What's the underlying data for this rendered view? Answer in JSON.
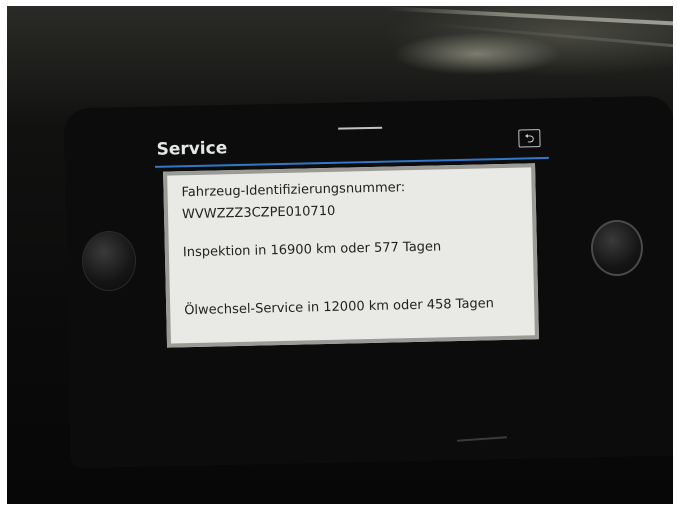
{
  "screen": {
    "title": "Service",
    "back_icon": "back-arrow-icon",
    "back_glyph": "⮌",
    "accent_color": "#2f78c8"
  },
  "service_info": {
    "vin_label": "Fahrzeug-Identifizierungsnummer:",
    "vin_value": "WVWZZZ3CZPE010710",
    "inspection": "Inspektion in 16900 km oder 577 Tagen",
    "oil_service": "Ölwechsel-Service in 12000 km oder 458 Tagen"
  }
}
